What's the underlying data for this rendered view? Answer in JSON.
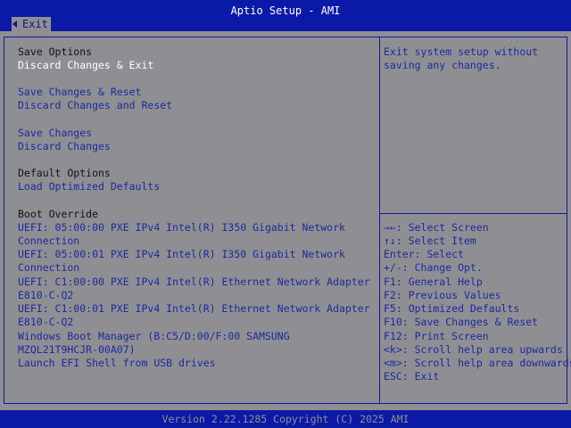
{
  "header": {
    "title": "Aptio Setup - AMI",
    "active_tab": "Exit"
  },
  "menu": {
    "save_options_heading": "Save Options",
    "discard_changes_exit": "Discard Changes & Exit",
    "save_changes_reset": "Save Changes & Reset",
    "discard_changes_reset": "Discard Changes and Reset",
    "save_changes": "Save Changes",
    "discard_changes": "Discard Changes",
    "default_options_heading": "Default Options",
    "load_optimized_defaults": "Load Optimized Defaults",
    "boot_override_heading": "Boot Override",
    "boot_items": [
      "UEFI: 05:00:00 PXE IPv4 Intel(R) I350 Gigabit Network",
      "Connection",
      "UEFI: 05:00:01 PXE IPv4 Intel(R) I350 Gigabit Network",
      "Connection",
      "UEFI: C1:00:00 PXE IPv4 Intel(R) Ethernet Network Adapter",
      "E810-C-Q2",
      "UEFI: C1:00:01 PXE IPv4 Intel(R) Ethernet Network Adapter",
      "E810-C-Q2",
      "Windows Boot Manager (B:C5/D:00/F:00 SAMSUNG",
      "MZQL21T9HCJR-00A07)",
      "Launch EFI Shell from USB drives"
    ]
  },
  "help": {
    "line1": "Exit system setup without",
    "line2": "saving any changes."
  },
  "keys": [
    "→←: Select Screen",
    "↑↓: Select Item",
    "Enter: Select",
    "+/-: Change Opt.",
    "F1: General Help",
    "F2: Previous Values",
    "F5: Optimized Defaults",
    "F10: Save Changes & Reset",
    "F12: Print Screen",
    "<k>: Scroll help area upwards",
    "<m>: Scroll help area downwards",
    "ESC: Exit"
  ],
  "footer": {
    "version": "Version 2.22.1285 Copyright (C) 2025 AMI"
  },
  "colors": {
    "blue_bar": "#0b1aa6",
    "background": "#8f8f93",
    "link_text": "#1b2a9c",
    "selected_text": "#ffffff"
  }
}
